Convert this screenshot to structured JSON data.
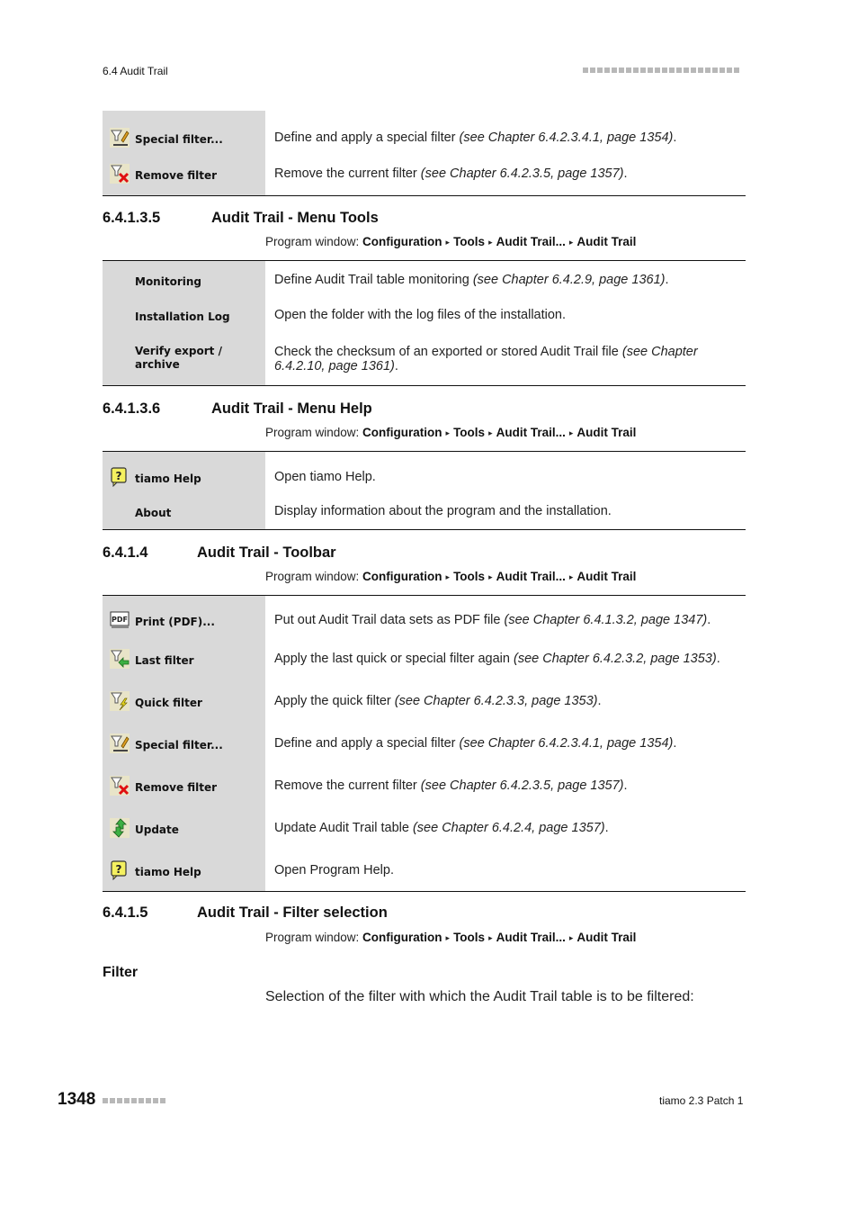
{
  "header": {
    "section": "6.4 Audit Trail",
    "dot_count": 22
  },
  "tables": {
    "filter_cont": [
      {
        "icon": "special-filter-icon",
        "label": "Special filter...",
        "text": "Define and apply a special filter ",
        "cite": "(see Chapter 6.4.2.3.4.1, page 1354)",
        "end": "."
      },
      {
        "icon": "remove-filter-icon",
        "label": "Remove filter",
        "text": "Remove the current filter ",
        "cite": "(see Chapter 6.4.2.3.5, page 1357)",
        "end": "."
      }
    ],
    "tools": [
      {
        "icon": "",
        "label": "Monitoring",
        "text": "Define Audit Trail table monitoring ",
        "cite": "(see Chapter 6.4.2.9, page 1361)",
        "end": "."
      },
      {
        "icon": "",
        "label": "Installation Log",
        "text": "Open the folder with the log files of the installation.",
        "cite": "",
        "end": ""
      },
      {
        "icon": "",
        "label": "Verify export / archive",
        "text": "Check the checksum of an exported or stored Audit Trail file ",
        "cite": "(see Chapter 6.4.2.10, page 1361)",
        "end": "."
      }
    ],
    "help": [
      {
        "icon": "help-icon",
        "label": "tiamo Help",
        "text": "Open tiamo Help.",
        "cite": "",
        "end": ""
      },
      {
        "icon": "",
        "label": "About",
        "text": "Display information about the program and the installation.",
        "cite": "",
        "end": ""
      }
    ],
    "toolbar": [
      {
        "icon": "pdf-icon",
        "label": "Print (PDF)...",
        "text": "Put out Audit Trail data sets as PDF file ",
        "cite": "(see Chapter 6.4.1.3.2, page 1347)",
        "end": "."
      },
      {
        "icon": "last-filter-icon",
        "label": "Last filter",
        "text": "Apply the last quick or special filter again ",
        "cite": "(see Chapter 6.4.2.3.2, page 1353)",
        "end": "."
      },
      {
        "icon": "quick-filter-icon",
        "label": "Quick filter",
        "text": "Apply the quick filter ",
        "cite": "(see Chapter 6.4.2.3.3, page 1353)",
        "end": "."
      },
      {
        "icon": "special-filter-icon",
        "label": "Special filter...",
        "text": "Define and apply a special filter ",
        "cite": "(see Chapter 6.4.2.3.4.1, page 1354)",
        "end": "."
      },
      {
        "icon": "remove-filter-icon",
        "label": "Remove filter",
        "text": "Remove the current filter ",
        "cite": "(see Chapter 6.4.2.3.5, page 1357)",
        "end": "."
      },
      {
        "icon": "update-icon",
        "label": "Update",
        "text": "Update Audit Trail table ",
        "cite": "(see Chapter 6.4.2.4, page 1357)",
        "end": "."
      },
      {
        "icon": "help-icon",
        "label": "tiamo Help",
        "text": "Open Program Help.",
        "cite": "",
        "end": ""
      }
    ]
  },
  "sections": {
    "tools": {
      "number": "6.4.1.3.5",
      "title": "Audit Trail - Menu Tools"
    },
    "help": {
      "number": "6.4.1.3.6",
      "title": "Audit Trail - Menu Help"
    },
    "toolbar": {
      "number": "6.4.1.4",
      "title": "Audit Trail - Toolbar"
    },
    "filter": {
      "number": "6.4.1.5",
      "title": "Audit Trail - Filter selection"
    }
  },
  "path": {
    "prefix": "Program window: ",
    "steps": [
      "Configuration",
      "Tools",
      "Audit Trail...",
      "Audit Trail"
    ],
    "separator": "▸"
  },
  "filter_param": {
    "heading": "Filter",
    "description": "Selection of the filter with which the Audit Trail table is to be filtered:"
  },
  "footer": {
    "page_number": "1348",
    "dot_count": 9,
    "product": "tiamo 2.3 Patch 1"
  }
}
